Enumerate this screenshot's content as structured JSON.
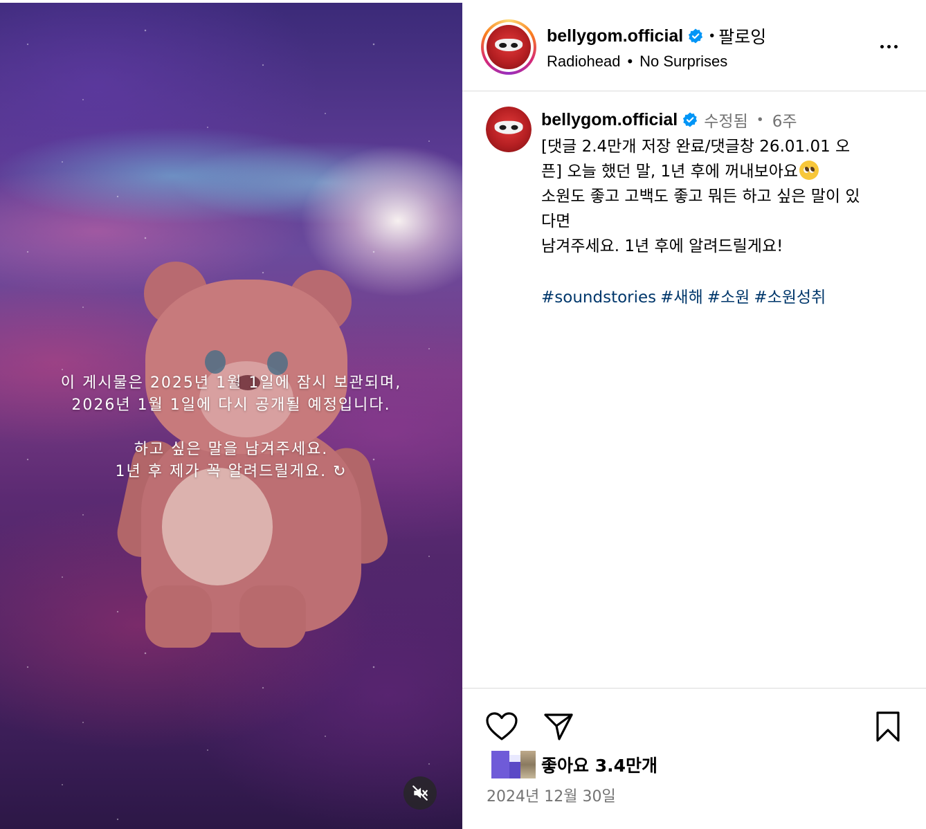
{
  "media": {
    "overlay_line1": "이 게시물은 2025년 1월 1일에 잠시 보관되며,",
    "overlay_line2": "2026년 1월 1일에 다시 공개될 예정입니다.",
    "overlay_line3": "하고 싶은 말을 남겨주세요.",
    "overlay_line4": "1년 후 제가 꼭 알려드릴게요. ↻",
    "mute_icon": "speaker-muted-icon"
  },
  "header": {
    "username": "bellygom.official",
    "verified_icon": "verified-badge-icon",
    "separator": "•",
    "follow_label": "팔로잉",
    "music_artist": "Radiohead",
    "music_sep": "•",
    "music_title": "No Surprises",
    "more_icon": "more-options-icon"
  },
  "caption": {
    "username": "bellygom.official",
    "edited_label": "수정됨",
    "dot": "•",
    "age": "6주",
    "line1": "[댓글 2.4만개 저장 완료/댓글창 26.01.01 오",
    "line2": "픈] 오늘 했던 말, 1년 후에 꺼내보아요",
    "line3": "소원도 좋고 고백도 좋고 뭐든 하고 싶은 말이 있",
    "line4": "다면",
    "line5": "남겨주세요. 1년 후에 알려드릴게요!",
    "hashtags": [
      "#soundstories",
      "#새해",
      "#소원",
      "#소원성취"
    ]
  },
  "actions": {
    "like_icon": "heart-icon",
    "share_icon": "send-icon",
    "save_icon": "bookmark-icon",
    "likes_label": "좋아요 3.4만개",
    "date": "2024년 12월 30일"
  },
  "colors": {
    "link": "#00376b",
    "muted": "#737373",
    "verified": "#0095f6",
    "divider": "#dbdbdb"
  }
}
